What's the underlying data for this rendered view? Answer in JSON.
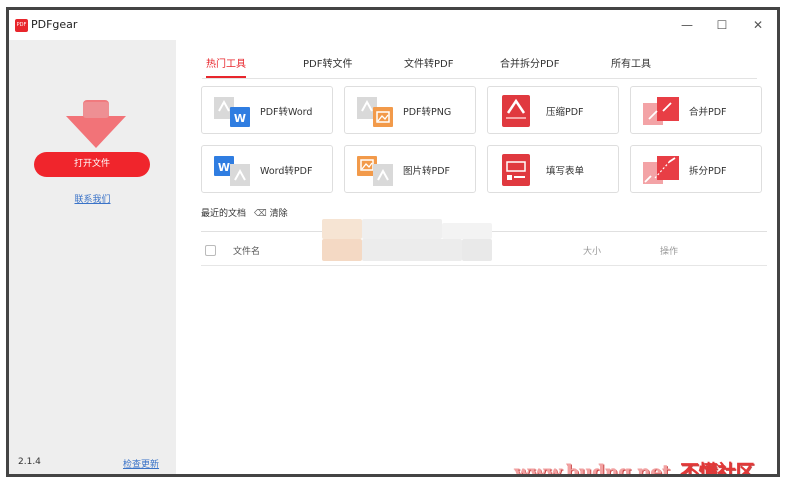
{
  "window": {
    "title": "PDFgear",
    "logo_text": "PDF",
    "minimize": "—",
    "maximize": "☐",
    "close": "✕"
  },
  "sidebar": {
    "open_file": "打开文件",
    "contact": "联系我们",
    "version": "2.1.4",
    "check_update": "检查更新"
  },
  "tabs": [
    {
      "label": "热门工具",
      "active": true
    },
    {
      "label": "PDF转文件",
      "active": false
    },
    {
      "label": "文件转PDF",
      "active": false
    },
    {
      "label": "合并拆分PDF",
      "active": false
    },
    {
      "label": "所有工具",
      "active": false
    }
  ],
  "tools": [
    {
      "label": "PDF转Word",
      "icon": "pdf-to-word-icon"
    },
    {
      "label": "PDF转PNG",
      "icon": "pdf-to-png-icon"
    },
    {
      "label": "压缩PDF",
      "icon": "compress-pdf-icon"
    },
    {
      "label": "合并PDF",
      "icon": "merge-pdf-icon"
    },
    {
      "label": "Word转PDF",
      "icon": "word-to-pdf-icon"
    },
    {
      "label": "图片转PDF",
      "icon": "image-to-pdf-icon"
    },
    {
      "label": "填写表单",
      "icon": "fill-form-icon"
    },
    {
      "label": "拆分PDF",
      "icon": "split-pdf-icon"
    }
  ],
  "recent": {
    "header": "最近的文档",
    "clear": "清除",
    "columns": {
      "name": "文件名",
      "size": "大小",
      "action": "操作"
    }
  },
  "watermark": {
    "url": "www.budng.net",
    "cn": "不懂社区"
  },
  "colors": {
    "accent": "#e8262c",
    "link": "#3a73c8",
    "sidebar_bg": "#eeeeee"
  }
}
